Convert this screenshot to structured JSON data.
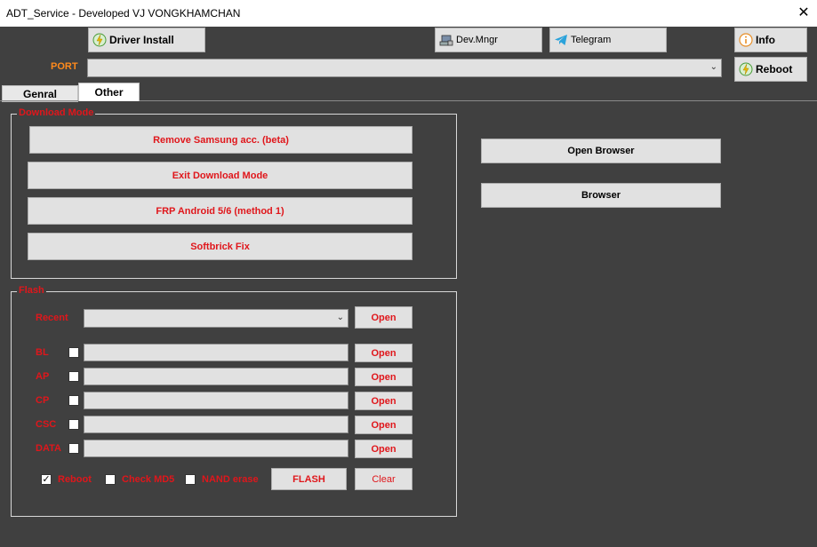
{
  "window": {
    "title": "ADT_Service - Developed VJ VONGKHAMCHAN",
    "close_glyph": "✕"
  },
  "toolbar": {
    "driver_install": "Driver Install",
    "dev_mngr": "Dev.Mngr",
    "telegram": "Telegram",
    "info": "Info",
    "reboot": "Reboot"
  },
  "port": {
    "label": "PORT",
    "value": ""
  },
  "tabs": [
    {
      "label": "Genral"
    },
    {
      "label": "Other"
    }
  ],
  "download_mode": {
    "title": "Download Mode",
    "buttons": [
      "Remove Samsung acc. (beta)",
      "Exit Download Mode",
      "FRP Android 5/6 (method 1)",
      "Softbrick Fix"
    ]
  },
  "browser": {
    "open_browser": "Open Browser",
    "browser": "Browser"
  },
  "flash": {
    "title": "Flash",
    "recent_label": "Recent",
    "recent_value": "",
    "open_label": "Open",
    "rows": [
      {
        "label": "BL",
        "value": ""
      },
      {
        "label": "AP",
        "value": ""
      },
      {
        "label": "CP",
        "value": ""
      },
      {
        "label": "CSC",
        "value": ""
      },
      {
        "label": "DATA",
        "value": ""
      }
    ],
    "options": [
      {
        "label": "Reboot",
        "checked": true
      },
      {
        "label": "Check MD5",
        "checked": false
      },
      {
        "label": "NAND erase",
        "checked": false
      }
    ],
    "flash_button": "FLASH",
    "clear_button": "Clear"
  },
  "colors": {
    "background": "#404040",
    "accent_red": "#e0161b",
    "port_orange": "#ff8a1c"
  },
  "icons": {
    "driver": "bolt-icon",
    "devmgr": "device-manager-icon",
    "telegram": "telegram-icon",
    "info": "info-icon",
    "reboot": "bolt-icon"
  }
}
